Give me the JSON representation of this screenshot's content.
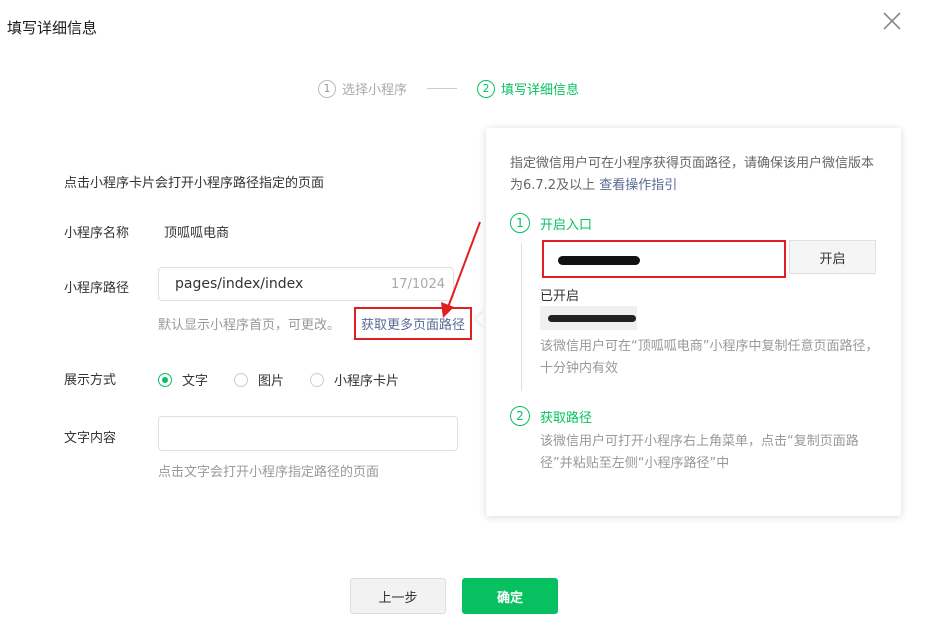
{
  "dialog": {
    "title": "填写详细信息"
  },
  "steps": [
    {
      "num": "1",
      "label": "选择小程序"
    },
    {
      "num": "2",
      "label": "填写详细信息"
    }
  ],
  "form": {
    "intro": "点击小程序卡片会打开小程序路径指定的页面",
    "name_label": "小程序名称",
    "name_value": "顶呱呱电商",
    "path_label": "小程序路径",
    "path_value": "pages/index/index",
    "path_count": "17/1024",
    "path_hint": "默认显示小程序首页，可更改。",
    "more_paths_link": "获取更多页面路径",
    "display_label": "展示方式",
    "display_options": [
      "文字",
      "图片",
      "小程序卡片"
    ],
    "display_selected": "文字",
    "text_label": "文字内容",
    "text_value": "",
    "text_hint": "点击文字会打开小程序指定路径的页面"
  },
  "popover": {
    "desc": "指定微信用户可在小程序获得页面路径，请确保该用户微信版本为6.7.2及以上",
    "guide_link": "查看操作指引",
    "step1_num": "1",
    "step1_title": "开启入口",
    "open_button": "开启",
    "opened_label": "已开启",
    "step1_note": "该微信用户可在“顶呱呱电商”小程序中复制任意页面路径，十分钟内有效",
    "step2_num": "2",
    "step2_title": "获取路径",
    "step2_note": "该微信用户可打开小程序右上角菜单，点击“复制页面路径”并粘贴至左侧“小程序路径”中"
  },
  "buttons": {
    "prev": "上一步",
    "confirm": "确定"
  },
  "colors": {
    "accent": "#07c160",
    "link": "#576b95",
    "annotation": "#e02020"
  }
}
